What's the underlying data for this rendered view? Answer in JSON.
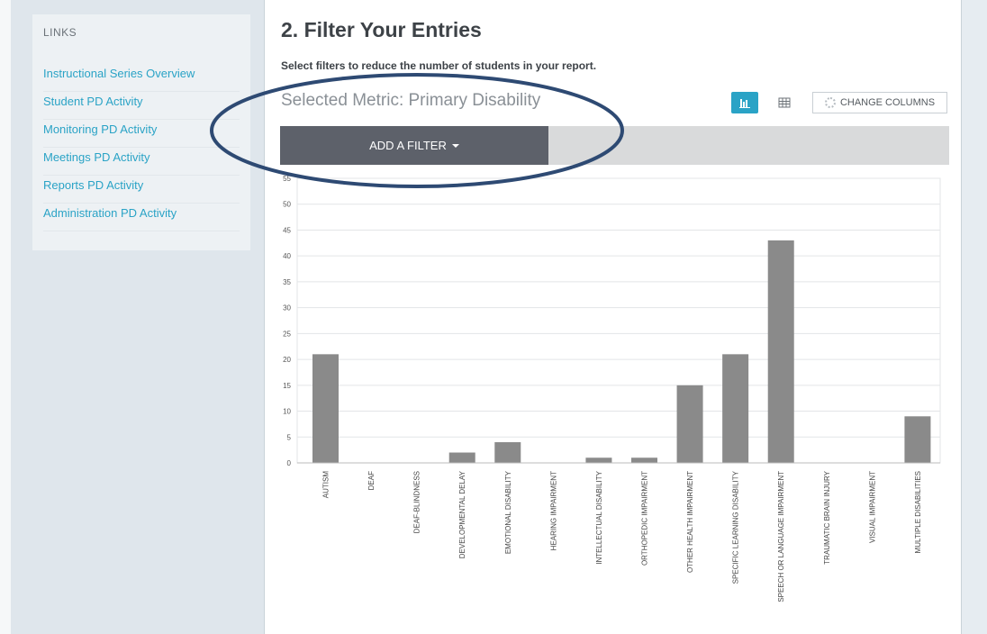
{
  "sidebar": {
    "heading": "LINKS",
    "items": [
      {
        "label": "Instructional Series Overview"
      },
      {
        "label": "Student PD Activity"
      },
      {
        "label": "Monitoring PD Activity"
      },
      {
        "label": "Meetings PD Activity"
      },
      {
        "label": "Reports PD Activity"
      },
      {
        "label": "Administration PD Activity"
      }
    ]
  },
  "main": {
    "title": "2. Filter Your Entries",
    "subtitle": "Select filters to reduce the number of students in your report.",
    "metric": "Selected Metric: Primary Disability",
    "change_columns_label": "CHANGE COLUMNS",
    "add_filter_label": "ADD A FILTER",
    "view_buttons": {
      "chart_icon": "bar-chart-icon",
      "table_icon": "table-grid-icon"
    }
  },
  "colors": {
    "accent": "#2aa3c6",
    "bar": "#8a8a8a",
    "filter_button": "#5d616a",
    "annotation": "#2e4a73"
  },
  "chart_data": {
    "type": "bar",
    "categories": [
      "AUTISM",
      "DEAF",
      "DEAF-BLINDNESS",
      "DEVELOPMENTAL DELAY",
      "EMOTIONAL DISABILITY",
      "HEARING IMPAIRMENT",
      "INTELLECTUAL DISABILITY",
      "ORTHOPEDIC IMPAIRMENT",
      "OTHER HEALTH IMPAIRMENT",
      "SPECIFIC LEARNING DISABILITY",
      "SPEECH OR LANGUAGE IMPAIRMENT",
      "TRAUMATIC BRAIN INJURY",
      "VISUAL IMPAIRMENT",
      "MULTIPLE DISABILITIES"
    ],
    "values": [
      21,
      0,
      0,
      2,
      4,
      0,
      1,
      1,
      15,
      21,
      43,
      0,
      0,
      9
    ],
    "yticks": [
      0,
      5,
      10,
      15,
      20,
      25,
      30,
      35,
      40,
      45,
      50,
      55
    ],
    "ylim": [
      0,
      55
    ],
    "grid": true
  }
}
